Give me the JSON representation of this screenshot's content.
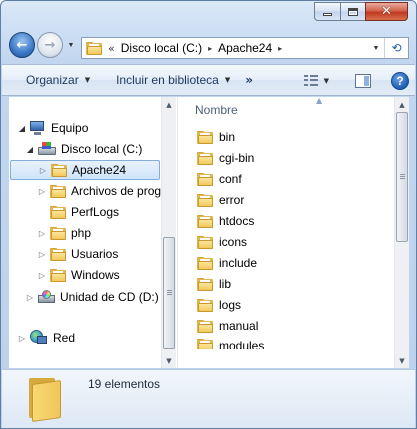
{
  "window": {
    "caption_buttons": {
      "minimize": "",
      "maximize": "",
      "close": "✕"
    }
  },
  "navigation": {
    "back_icon": "back-arrow-icon",
    "forward_icon": "forward-arrow-icon"
  },
  "address_bar": {
    "overflow_marker": "«",
    "breadcrumbs": [
      "Disco local (C:)",
      "Apache24"
    ],
    "separator": "▸"
  },
  "toolbar": {
    "organize_label": "Organizar",
    "library_label": "Incluir en biblioteca",
    "more_label": "»"
  },
  "nav_pane": {
    "items": [
      {
        "label": "Equipo",
        "icon": "computer-icon"
      },
      {
        "label": "Disco local (C:)",
        "icon": "drive-icon"
      },
      {
        "label": "Apache24",
        "icon": "folder-icon",
        "selected": true
      },
      {
        "label": "Archivos de prog",
        "icon": "folder-icon"
      },
      {
        "label": "PerfLogs",
        "icon": "folder-icon"
      },
      {
        "label": "php",
        "icon": "folder-icon"
      },
      {
        "label": "Usuarios",
        "icon": "folder-icon"
      },
      {
        "label": "Windows",
        "icon": "folder-icon"
      },
      {
        "label": "Unidad de CD (D:)",
        "icon": "cd-drive-icon"
      },
      {
        "label": "Red",
        "icon": "network-icon"
      }
    ]
  },
  "content": {
    "column_header": "Nombre",
    "files": [
      "bin",
      "cgi-bin",
      "conf",
      "error",
      "htdocs",
      "icons",
      "include",
      "lib",
      "logs",
      "manual",
      "modules"
    ]
  },
  "details": {
    "item_count": "19 elementos"
  },
  "colors": {
    "frame_accent": "#5f7fa6",
    "selection": "#cfe4fa",
    "close_button": "#c0391f",
    "toolbar_text": "#1e395b"
  }
}
